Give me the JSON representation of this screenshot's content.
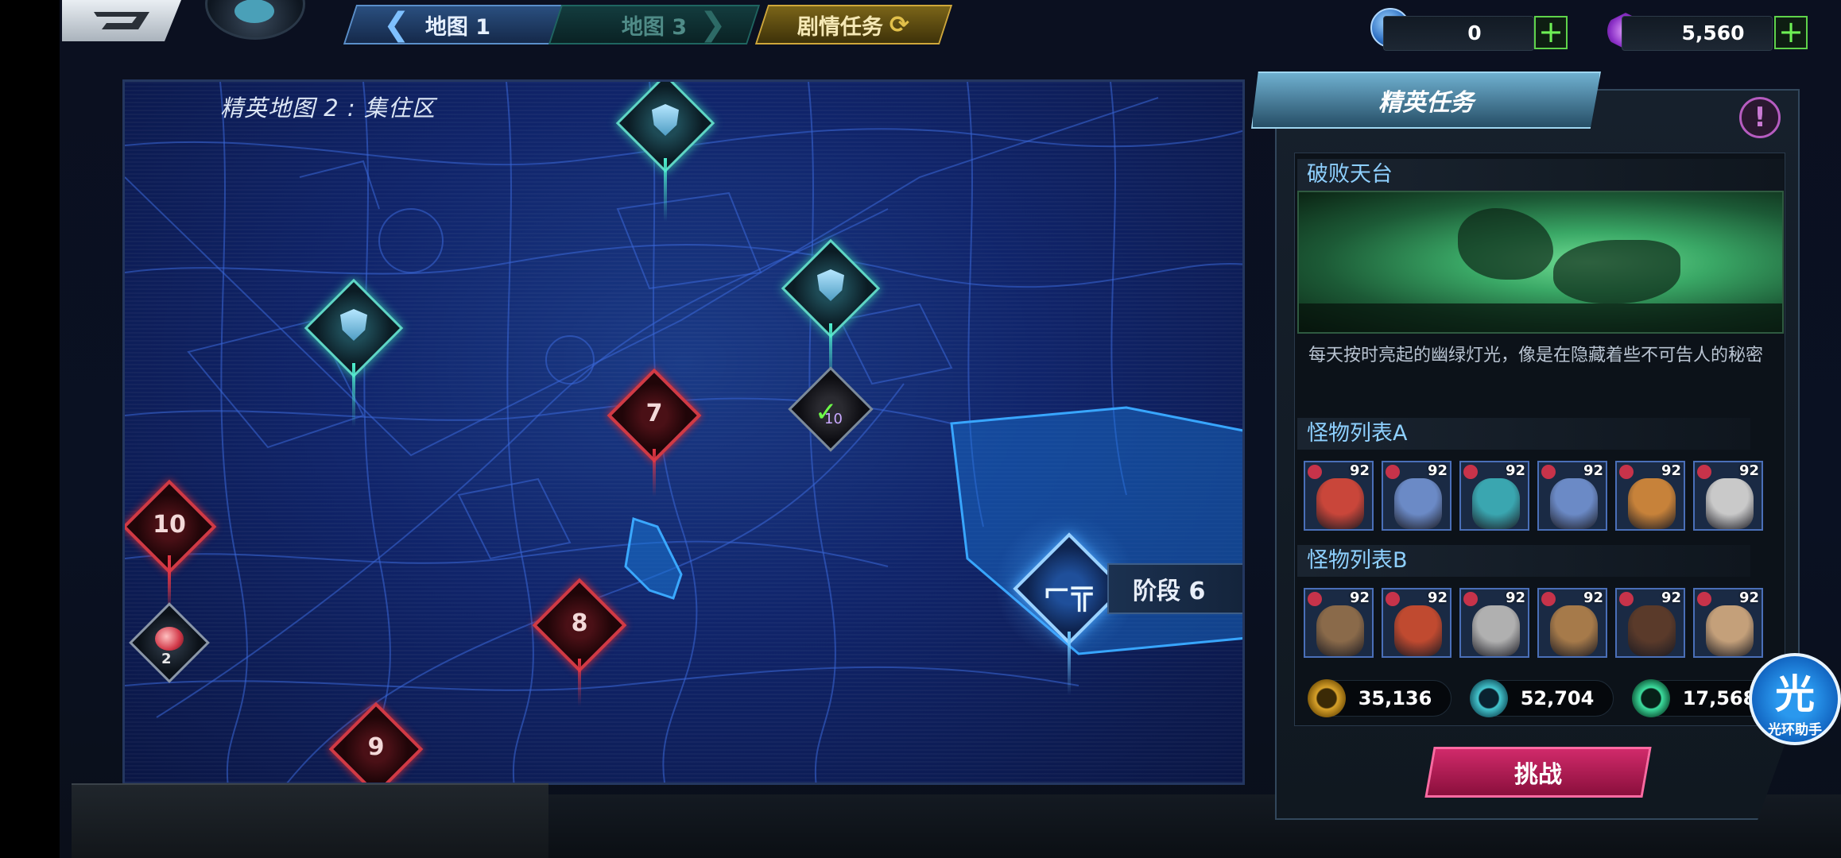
{
  "tabs": {
    "map1": "地图 1",
    "map3": "地图 3",
    "story": "剧情任务"
  },
  "currencies": [
    {
      "name": "coin",
      "value": "0"
    },
    {
      "name": "gem",
      "value": "5,560"
    }
  ],
  "map": {
    "title": "精英地图 2 : 集住区",
    "nodes": {
      "n7": "7",
      "n8": "8",
      "n9": "9",
      "n10": "10",
      "item_count": "2",
      "done_count": "10"
    },
    "current_stage": "阶段 6"
  },
  "panel": {
    "title": "精英任务",
    "info": "!",
    "stage_name": "破败天台",
    "description": "每天按时亮起的幽绿灯光，像是在隐藏着些不可告人的秘密",
    "monster_list_a": "怪物列表A",
    "monster_list_b": "怪物列表B",
    "monsters_a": [
      {
        "level": "92",
        "color": "#c9463a"
      },
      {
        "level": "92",
        "color": "#6b8ac6"
      },
      {
        "level": "92",
        "color": "#3aa6b0"
      },
      {
        "level": "92",
        "color": "#6b8ac6"
      },
      {
        "level": "92",
        "color": "#c7823a"
      },
      {
        "level": "92",
        "color": "#c9c9c9"
      }
    ],
    "monsters_b": [
      {
        "level": "92",
        "color": "#8a6a4a"
      },
      {
        "level": "92",
        "color": "#c04a30"
      },
      {
        "level": "92",
        "color": "#b0b0b0"
      },
      {
        "level": "92",
        "color": "#a67a4a"
      },
      {
        "level": "92",
        "color": "#5a3a2a"
      },
      {
        "level": "92",
        "color": "#c4a07a"
      }
    ],
    "rewards": [
      {
        "name": "gold",
        "value": "35,136"
      },
      {
        "name": "exp",
        "value": "52,704"
      },
      {
        "name": "crystal",
        "value": "17,568"
      }
    ],
    "challenge": "挑战"
  },
  "assist": {
    "big": "光",
    "small": "光环助手"
  }
}
